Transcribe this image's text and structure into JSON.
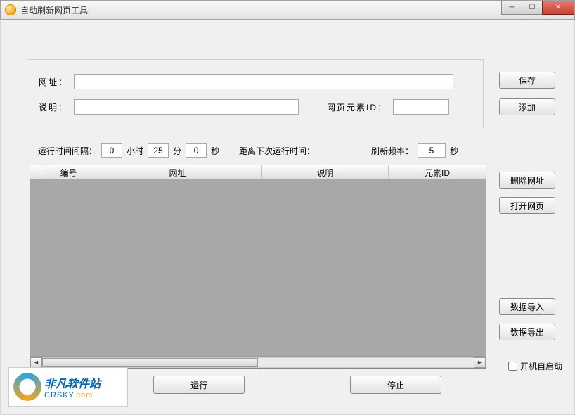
{
  "window": {
    "title": "自动刷新网页工具"
  },
  "form": {
    "url_label": "网址：",
    "url_value": "",
    "desc_label": "说明：",
    "desc_value": "",
    "element_id_label": "网页元素ID：",
    "element_id_value": ""
  },
  "interval": {
    "label": "运行时间间隔：",
    "hours": "0",
    "hours_unit": "小时",
    "minutes": "25",
    "minutes_unit": "分",
    "seconds": "0",
    "seconds_unit": "秒"
  },
  "next_run_label": "距离下次运行时间：",
  "freq": {
    "label": "刷新频率：",
    "value": "5",
    "unit": "秒"
  },
  "table": {
    "columns": [
      "编号",
      "网址",
      "说明",
      "元素ID"
    ],
    "rows": []
  },
  "buttons": {
    "save": "保存",
    "add": "添加",
    "delete_url": "删除网址",
    "open_page": "打开网页",
    "import": "数据导入",
    "export": "数据导出",
    "run": "运行",
    "stop": "停止"
  },
  "autostart": {
    "label": "开机自启动",
    "checked": false
  },
  "logo": {
    "line1": "非凡软件站",
    "line2_a": "CRSKY",
    "line2_b": ".com"
  }
}
